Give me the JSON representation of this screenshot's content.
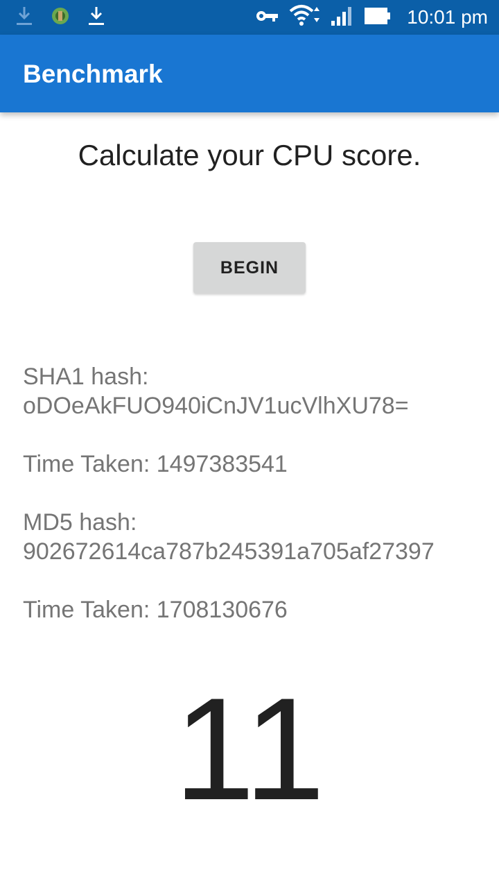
{
  "status_bar": {
    "time": "10:01 pm",
    "icons": [
      "download-icon",
      "app-notification-icon",
      "download-icon",
      "vpn-key-icon",
      "wifi-icon",
      "signal-icon",
      "battery-icon"
    ],
    "background_color": "#0b5fa8"
  },
  "app_bar": {
    "title": "Benchmark",
    "background_color": "#1976d2"
  },
  "main": {
    "headline": "Calculate your CPU score.",
    "begin_button_label": "BEGIN",
    "sha1_label": "SHA1 hash:",
    "sha1_value": "oDOeAkFUO940iCnJV1ucVlhXU78=",
    "sha1_time": "Time Taken: 1497383541",
    "md5_label": "MD5 hash:",
    "md5_value": "902672614ca787b245391a705af27397",
    "md5_time": "Time Taken: 1708130676",
    "score": "11"
  }
}
